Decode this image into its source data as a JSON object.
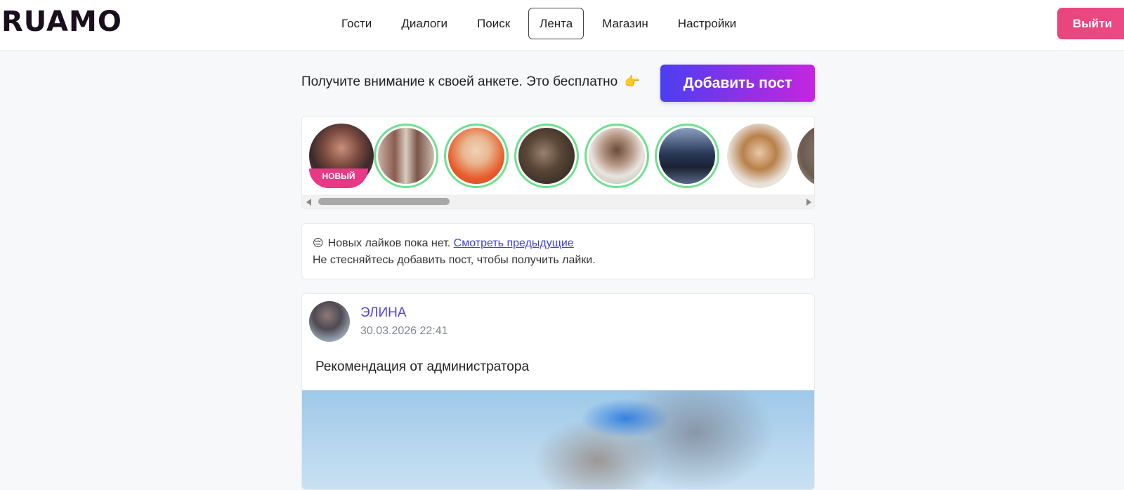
{
  "header": {
    "logo": "RUAMO",
    "nav": [
      "Гости",
      "Диалоги",
      "Поиск",
      "Лента",
      "Магазин",
      "Настройки"
    ],
    "active_nav": "Лента",
    "logout": "Выйти"
  },
  "promo": {
    "text": "Получите внимание к своей анкете. Это бесплатно",
    "emoji": "👉",
    "add_post": "Добавить пост"
  },
  "stories": {
    "new_badge": "НОВЫЙ"
  },
  "likes": {
    "emoji": "😔",
    "line1": "Новых лайков пока нет.",
    "link": "Смотреть предыдущие",
    "line2": "Не стесняйтесь добавить пост, чтобы получить лайки."
  },
  "post": {
    "author": "ЭЛИНА",
    "date": "30.03.2026 22:41",
    "text": "Рекомендация от администратора"
  },
  "colors": {
    "accent": "#5244dc",
    "logout": "#ec4a86",
    "add_post_start": "#4b3ff0",
    "add_post_end": "#c625de",
    "story_ring": "#6ee08f"
  }
}
